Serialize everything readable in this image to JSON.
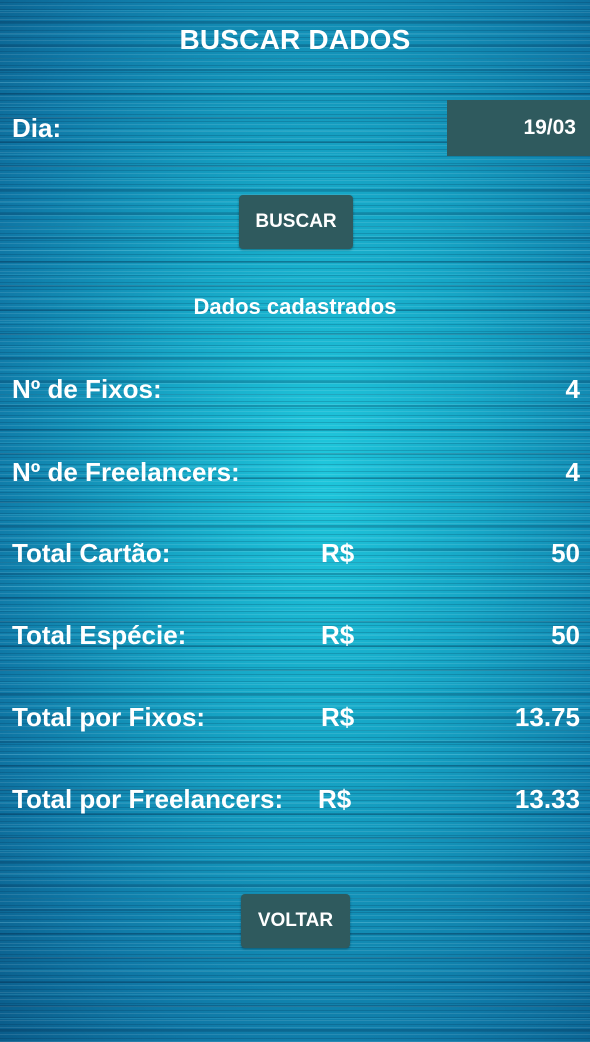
{
  "header": {
    "title": "BUSCAR DADOS"
  },
  "search": {
    "day_label": "Dia:",
    "day_value": "19/03",
    "button_label": "BUSCAR"
  },
  "results": {
    "section_title": "Dados cadastrados",
    "fixed_count": {
      "label": "Nº de Fixos:",
      "value": "4"
    },
    "freelancer_count": {
      "label": "Nº de Freelancers:",
      "value": "4"
    },
    "total_card": {
      "label": "Total Cartão:",
      "currency": "R$",
      "value": "50"
    },
    "total_cash": {
      "label": "Total Espécie:",
      "currency": "R$",
      "value": "50"
    },
    "total_per_fixed": {
      "label": "Total por Fixos:",
      "currency": "R$",
      "value": "13.75"
    },
    "total_per_freelancer": {
      "label": "Total por Freelancers:",
      "currency": "R$",
      "value": "13.33"
    }
  },
  "footer": {
    "back_label": "VOLTAR"
  },
  "colors": {
    "button_bg": "#2f5a5e",
    "text": "#ffffff",
    "background": "#1a8fb0"
  }
}
